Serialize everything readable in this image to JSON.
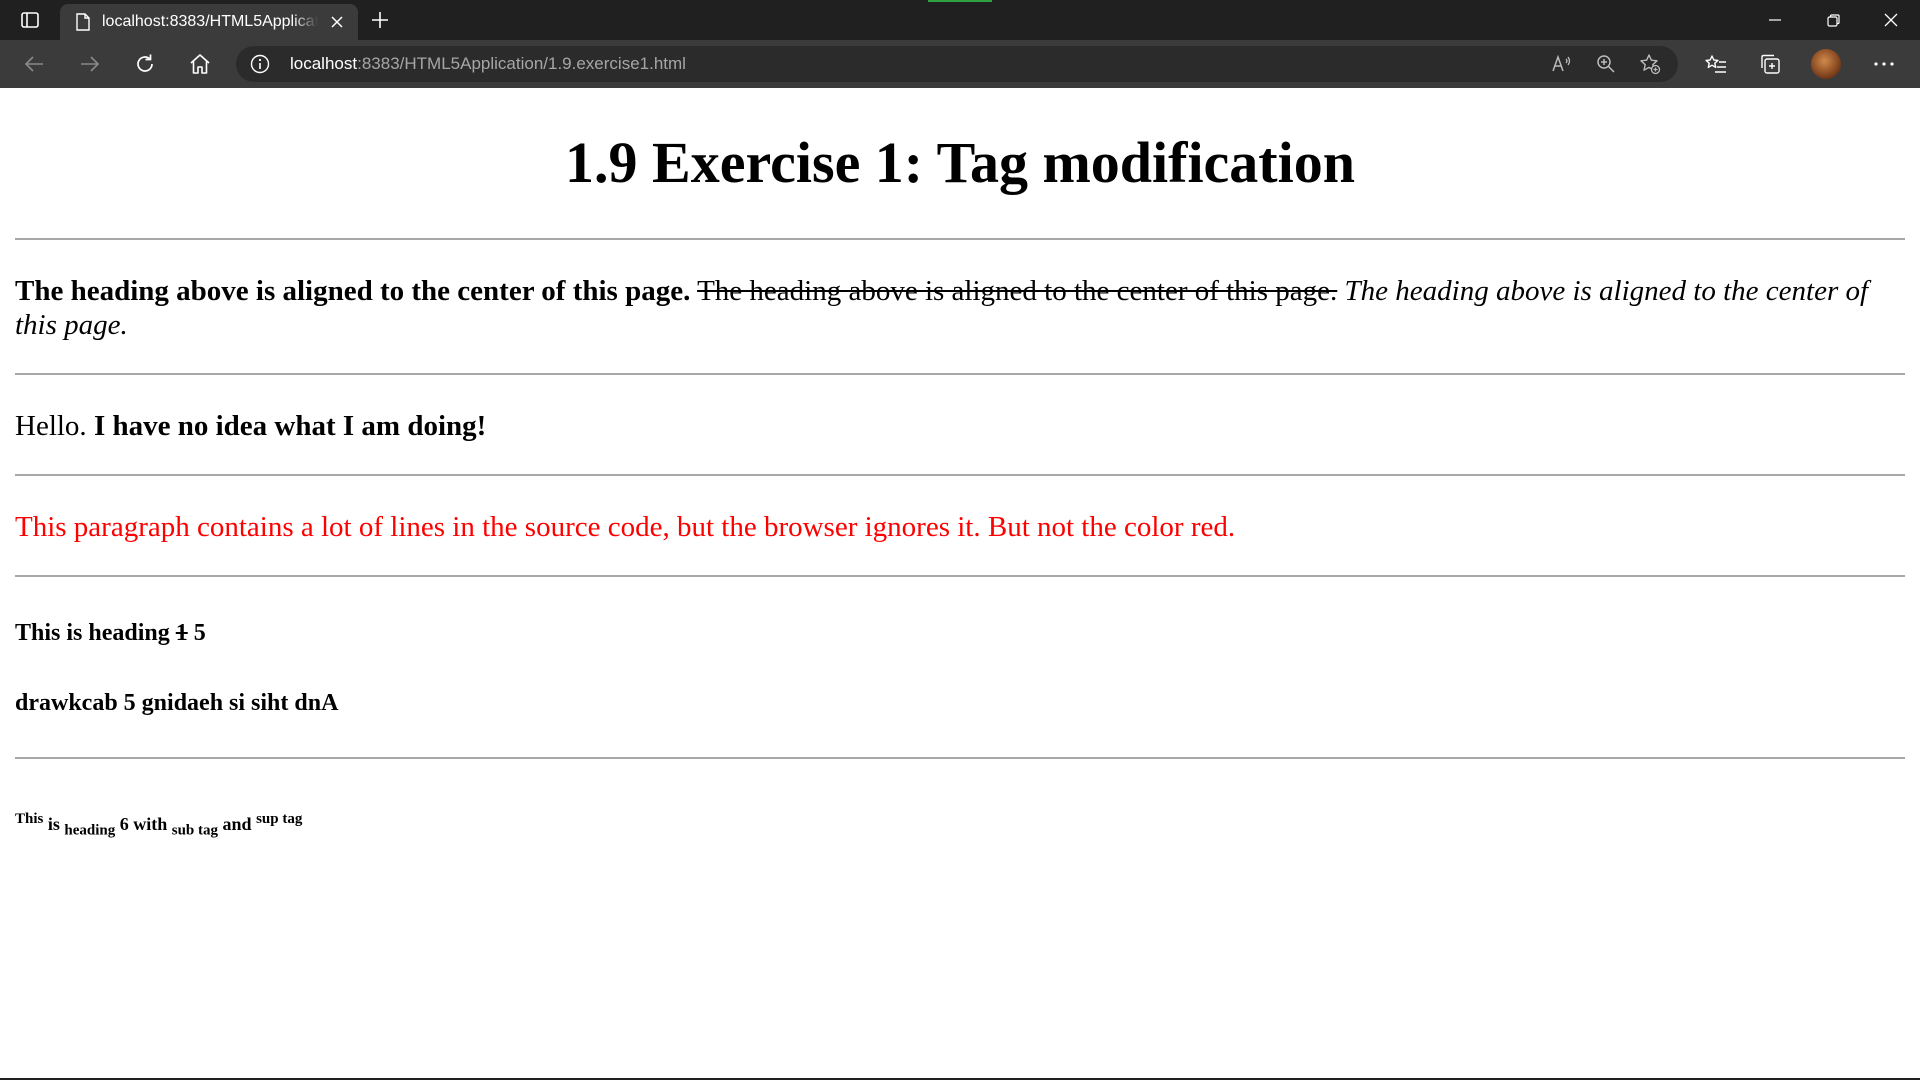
{
  "browser": {
    "tab": {
      "title": "localhost:8383/HTML5Application/1.9.exercise1.html"
    },
    "url": {
      "host": "localhost",
      "rest": ":8383/HTML5Application/1.9.exercise1.html"
    },
    "icons": {
      "tab_actions": "tab-actions-icon",
      "page": "page-icon",
      "close": "close-icon",
      "new_tab": "plus-icon",
      "back": "back-arrow-icon",
      "forward": "forward-arrow-icon",
      "refresh": "refresh-icon",
      "home": "home-icon",
      "info": "info-icon",
      "read_aloud": "read-aloud-icon",
      "zoom": "zoom-icon",
      "add_favorite": "add-favorite-icon",
      "favorites": "favorites-icon",
      "collections": "collections-icon",
      "more": "more-icon"
    }
  },
  "page": {
    "heading": "1.9 Exercise 1: Tag modification",
    "para1": {
      "bold": "The heading above is aligned to the center of this page.",
      "strike": "The heading above is aligned to the center of this page.",
      "italic": "The heading above is aligned to the center of this page."
    },
    "para2": {
      "plain": "Hello.",
      "bold": "I have no idea what I am doing!"
    },
    "para3": {
      "text": "This paragraph contains a lot of lines in the source code, but the browser ignores it. But not the color red.",
      "color": "#ff0000"
    },
    "h5a": {
      "before": "This is heading",
      "struck": "1",
      "after": "5"
    },
    "h5b": {
      "text": "drawkcab 5 gnidaeh si siht dnA"
    },
    "h6": {
      "p1": "This",
      "p2": "is",
      "p3": "heading",
      "p4": "6",
      "p5": "with",
      "p6": "sub tag",
      "p7": "and",
      "p8": "sup tag"
    }
  }
}
